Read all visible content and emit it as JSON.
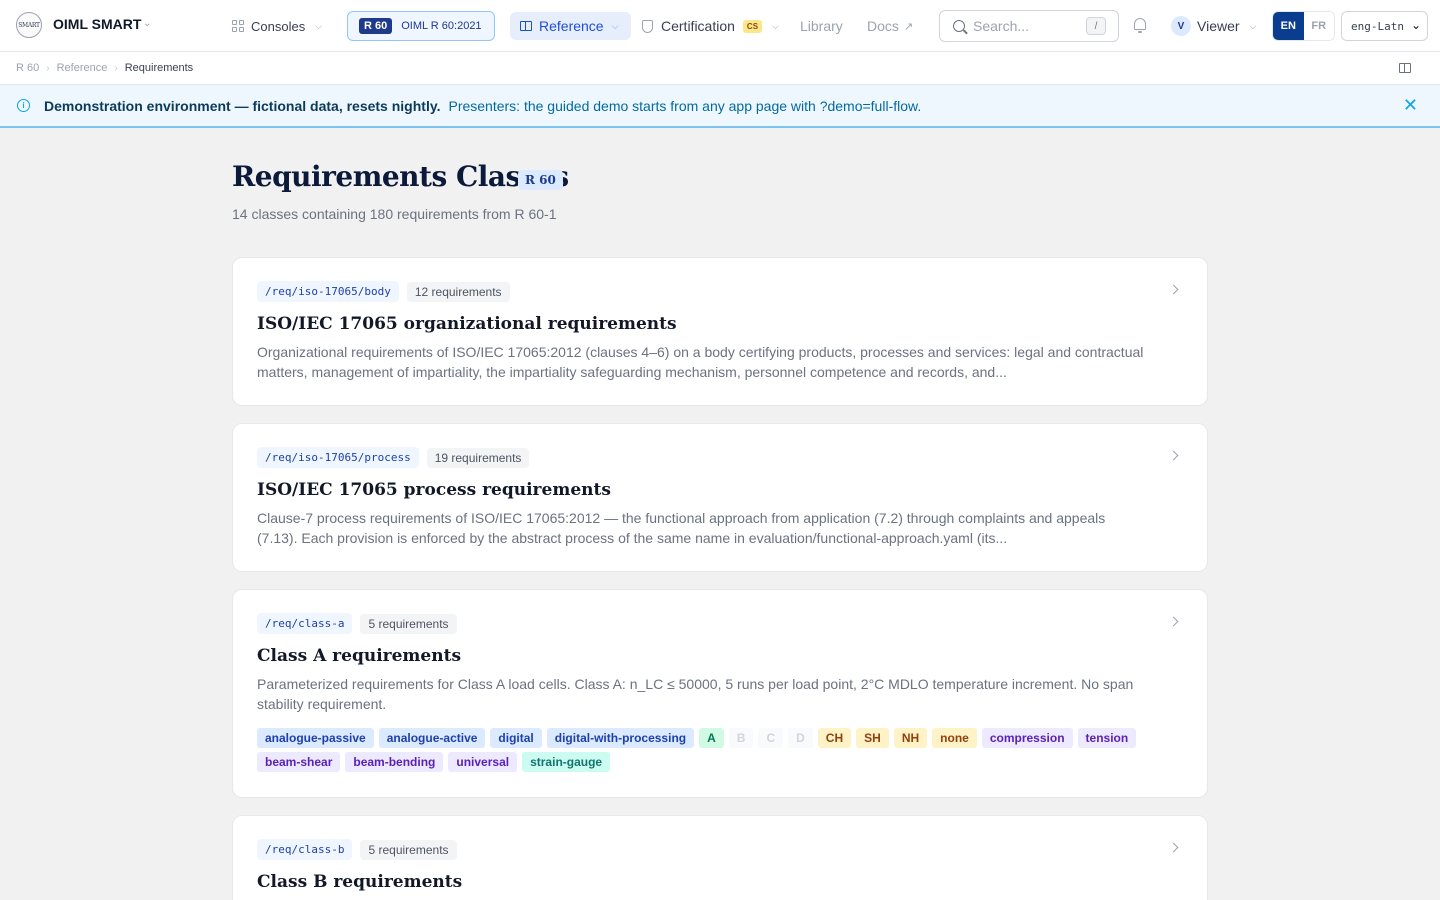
{
  "app": {
    "brand": "OIML SMART",
    "logo_text": "SMART"
  },
  "nav": {
    "consoles": "Consoles",
    "standard_code": "R 60",
    "standard_name": "OIML R 60:2021",
    "reference": "Reference",
    "certification": "Certification",
    "certification_badge": "CS",
    "library": "Library",
    "docs": "Docs",
    "search_placeholder": "Search...",
    "search_shortcut": "/",
    "user_initial": "V",
    "user_role": "Viewer",
    "lang_en": "EN",
    "lang_fr": "FR",
    "script": "eng-Latn"
  },
  "breadcrumb": {
    "items": [
      "R 60",
      "Reference",
      "Requirements"
    ]
  },
  "banner": {
    "bold": "Demonstration environment — fictional data, resets nightly.",
    "text": "Presenters: the guided demo starts from any app page with ?demo=full-flow."
  },
  "page": {
    "title": "Requirements Classes",
    "badge": "R 60",
    "subtitle": "14 classes containing 180 requirements from R 60-1"
  },
  "cards": [
    {
      "code": "/req/iso-17065/body",
      "count": "12 requirements",
      "title": "ISO/IEC 17065 organizational requirements",
      "desc": "Organizational requirements of ISO/IEC 17065:2012 (clauses 4–6) on a body certifying products, processes and services: legal and contractual matters, management of impartiality, the impartiality safeguarding mechanism, personnel competence and records, and..."
    },
    {
      "code": "/req/iso-17065/process",
      "count": "19 requirements",
      "title": "ISO/IEC 17065 process requirements",
      "desc": "Clause-7 process requirements of ISO/IEC 17065:2012 — the functional approach from application (7.2) through complaints and appeals (7.13). Each provision is enforced by the abstract process of the same name in evaluation/functional-approach.yaml (its..."
    },
    {
      "code": "/req/class-a",
      "count": "5 requirements",
      "title": "Class A requirements",
      "desc": "Parameterized requirements for Class A load cells. Class A: n_LC ≤ 50000, 5 runs per load point, 2°C MDLO temperature increment. No span stability requirement.",
      "tags": [
        {
          "label": "analogue-passive",
          "style": "blue"
        },
        {
          "label": "analogue-active",
          "style": "blue"
        },
        {
          "label": "digital",
          "style": "blue"
        },
        {
          "label": "digital-with-processing",
          "style": "blue"
        },
        {
          "label": "A",
          "style": "green"
        },
        {
          "label": "B",
          "style": "faded"
        },
        {
          "label": "C",
          "style": "faded"
        },
        {
          "label": "D",
          "style": "faded"
        },
        {
          "label": "CH",
          "style": "amber"
        },
        {
          "label": "SH",
          "style": "amber"
        },
        {
          "label": "NH",
          "style": "amber"
        },
        {
          "label": "none",
          "style": "amber"
        },
        {
          "label": "compression",
          "style": "purple"
        },
        {
          "label": "tension",
          "style": "purple"
        },
        {
          "label": "beam-shear",
          "style": "purple"
        },
        {
          "label": "beam-bending",
          "style": "purple"
        },
        {
          "label": "universal",
          "style": "purple"
        },
        {
          "label": "strain-gauge",
          "style": "teal"
        }
      ]
    },
    {
      "code": "/req/class-b",
      "count": "5 requirements",
      "title": "Class B requirements",
      "desc": ""
    }
  ],
  "colors": {
    "primary": "#0a3d8f",
    "accent": "#1d4ed8",
    "banner_bg": "#eef7fd",
    "title": "#0b1a3a"
  }
}
